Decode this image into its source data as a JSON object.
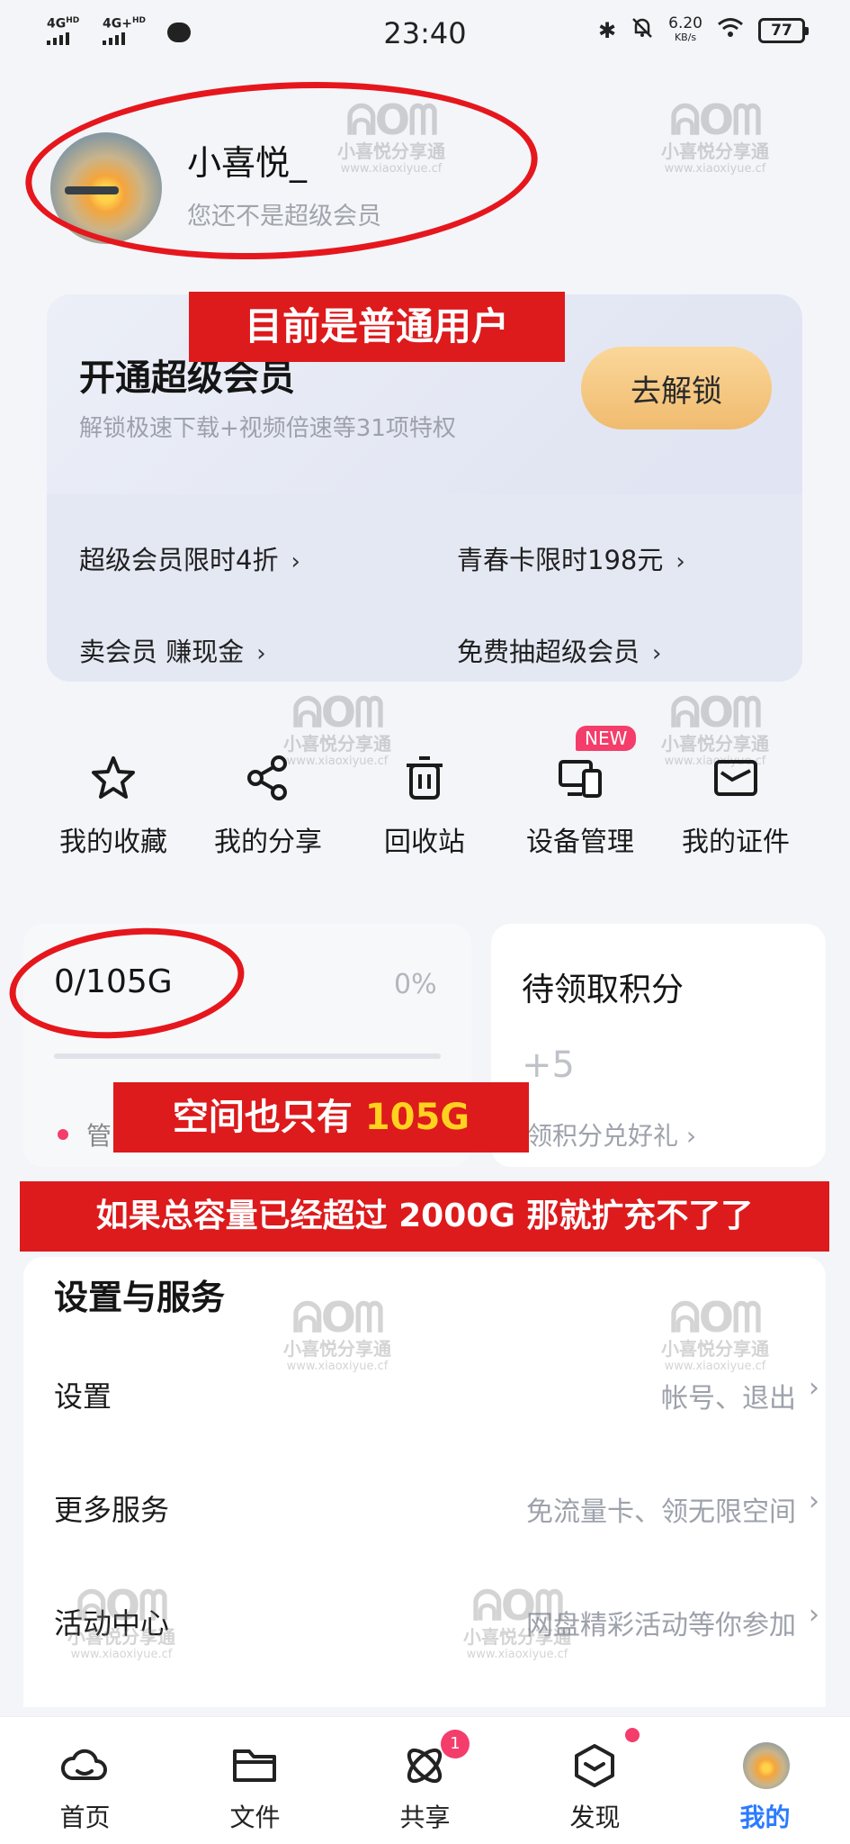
{
  "status_bar": {
    "net1": "4G",
    "net1_sup": "HD",
    "net2": "4G+",
    "net2_sup": "HD",
    "time": "23:40",
    "speed_value": "6.20",
    "speed_unit": "KB/s",
    "battery": "77"
  },
  "profile": {
    "username": "小喜悦_",
    "member_status": "您还不是超级会员"
  },
  "annotations": {
    "normal_user": "目前是普通用户",
    "space_prefix": "空间也只有",
    "space_highlight": "105G",
    "capacity_note": "如果总容量已经超过 2000G 那就扩充不了了"
  },
  "vip_card": {
    "title": "开通超级会员",
    "subtitle": "解锁极速下载+视频倍速等31项特权",
    "button": "去解锁",
    "links": [
      {
        "label": "超级会员限时4折"
      },
      {
        "label": "青春卡限时198元"
      },
      {
        "label": "卖会员 赚现金"
      },
      {
        "label": "免费抽超级会员"
      }
    ],
    "chevron": "›"
  },
  "shortcuts": [
    {
      "label": "我的收藏",
      "icon": "star-icon"
    },
    {
      "label": "我的分享",
      "icon": "share-icon"
    },
    {
      "label": "回收站",
      "icon": "trash-icon"
    },
    {
      "label": "设备管理",
      "icon": "devices-icon"
    },
    {
      "label": "我的证件",
      "icon": "id-card-icon"
    }
  ],
  "new_badge": "NEW",
  "storage": {
    "used": "0/105G",
    "percent_label": "0%",
    "percent": 0,
    "manage_label": "管"
  },
  "points": {
    "title": "待领取积分",
    "value": "+5",
    "link": "领积分兑好礼 ›"
  },
  "settings": {
    "title": "设置与服务",
    "rows": [
      {
        "label": "设置",
        "value": "帐号、退出"
      },
      {
        "label": "更多服务",
        "value": "免流量卡、领无限空间"
      },
      {
        "label": "活动中心",
        "value": "网盘精彩活动等你参加"
      }
    ],
    "chevron": "›"
  },
  "tabs": [
    {
      "label": "首页",
      "icon": "cloud-icon"
    },
    {
      "label": "文件",
      "icon": "folder-icon"
    },
    {
      "label": "共享",
      "icon": "orbit-icon",
      "badge": "1"
    },
    {
      "label": "发现",
      "icon": "cube-icon"
    },
    {
      "label": "我的",
      "icon": "avatar"
    }
  ],
  "watermark": {
    "logo": "ᕱOᗰ",
    "name": "小喜悦分享通",
    "url": "www.xiaoxiyue.cf"
  },
  "colors": {
    "accent_blue": "#2b7bff",
    "annotation_red": "#dd1a1c",
    "badge_pink": "#f43d6a",
    "unlock_gold": "#f0bb6f"
  }
}
